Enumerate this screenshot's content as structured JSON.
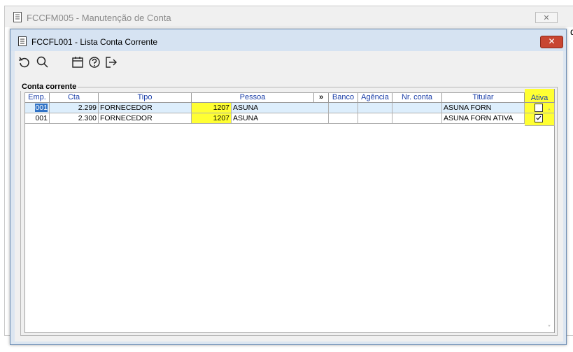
{
  "background_window": {
    "title": "FCCFM005 - Manutenção de Conta",
    "close_icon": "close-icon",
    "partial_text": "d"
  },
  "dialog": {
    "title": "FCCFL001 - Lista Conta Corrente",
    "close_icon": "close-icon",
    "close_color": "#c84632"
  },
  "toolbar": {
    "buttons": [
      "refresh-icon",
      "search-icon",
      "calendar-icon",
      "help-icon",
      "exit-icon"
    ]
  },
  "group": {
    "title": "Conta corrente"
  },
  "grid": {
    "columns": [
      "Emp.",
      "Cta",
      "Tipo",
      "Pessoa",
      "»",
      "Banco",
      "Agência",
      "Nr. conta",
      "Titular",
      "Ativa"
    ],
    "rows": [
      {
        "emp": "001",
        "cta": "2.299",
        "tipo": "FORNECEDOR",
        "pessoa_cod": "1207",
        "pessoa_nome": "ASUNA",
        "banco": "",
        "agencia": "",
        "nr_conta": "",
        "titular": "ASUNA FORN",
        "ativa": false
      },
      {
        "emp": "001",
        "cta": "2.300",
        "tipo": "FORNECEDOR",
        "pessoa_cod": "1207",
        "pessoa_nome": "ASUNA",
        "banco": "",
        "agencia": "",
        "nr_conta": "",
        "titular": "ASUNA FORN ATIVA",
        "ativa": true
      }
    ],
    "highlight_color": "#ffff33",
    "selection_color": "#3173c6"
  }
}
